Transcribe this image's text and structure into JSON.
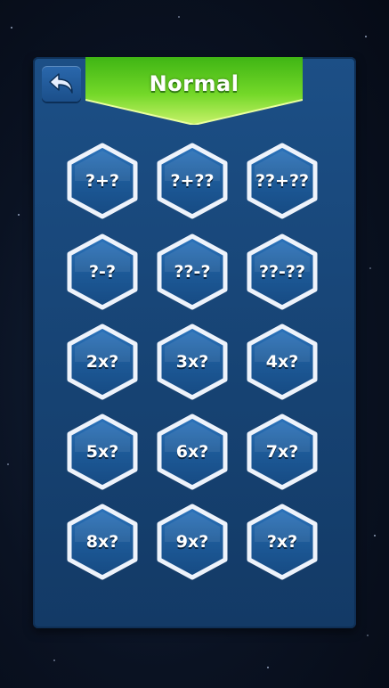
{
  "header": {
    "title": "Normal"
  },
  "back_button": {
    "icon": "back-arrow-icon"
  },
  "colors": {
    "ribbon_green": "#6fd629",
    "panel_blue": "#1a4a7e",
    "hex_fill": "#1d5a98",
    "hex_border": "#e8eef8"
  },
  "levels": [
    {
      "label": "?+?"
    },
    {
      "label": "?+??"
    },
    {
      "label": "??+??"
    },
    {
      "label": "?-?"
    },
    {
      "label": "??-?"
    },
    {
      "label": "??-??"
    },
    {
      "label": "2x?"
    },
    {
      "label": "3x?"
    },
    {
      "label": "4x?"
    },
    {
      "label": "5x?"
    },
    {
      "label": "6x?"
    },
    {
      "label": "7x?"
    },
    {
      "label": "8x?"
    },
    {
      "label": "9x?"
    },
    {
      "label": "?x?"
    }
  ]
}
